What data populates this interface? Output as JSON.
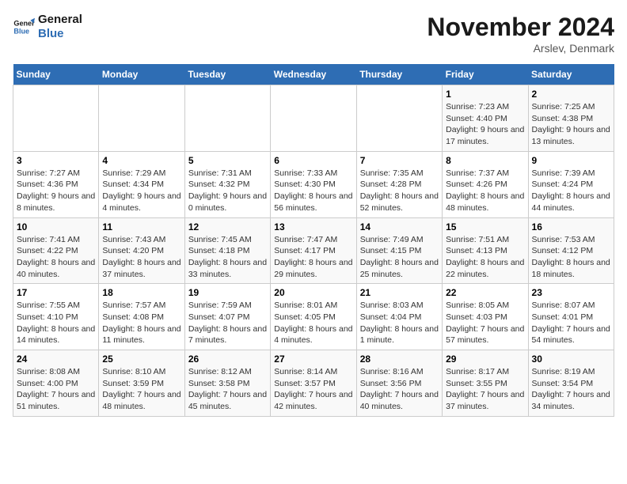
{
  "logo": {
    "line1": "General",
    "line2": "Blue"
  },
  "title": "November 2024",
  "subtitle": "Arslev, Denmark",
  "days_of_week": [
    "Sunday",
    "Monday",
    "Tuesday",
    "Wednesday",
    "Thursday",
    "Friday",
    "Saturday"
  ],
  "weeks": [
    [
      {
        "day": "",
        "info": ""
      },
      {
        "day": "",
        "info": ""
      },
      {
        "day": "",
        "info": ""
      },
      {
        "day": "",
        "info": ""
      },
      {
        "day": "",
        "info": ""
      },
      {
        "day": "1",
        "info": "Sunrise: 7:23 AM\nSunset: 4:40 PM\nDaylight: 9 hours and 17 minutes."
      },
      {
        "day": "2",
        "info": "Sunrise: 7:25 AM\nSunset: 4:38 PM\nDaylight: 9 hours and 13 minutes."
      }
    ],
    [
      {
        "day": "3",
        "info": "Sunrise: 7:27 AM\nSunset: 4:36 PM\nDaylight: 9 hours and 8 minutes."
      },
      {
        "day": "4",
        "info": "Sunrise: 7:29 AM\nSunset: 4:34 PM\nDaylight: 9 hours and 4 minutes."
      },
      {
        "day": "5",
        "info": "Sunrise: 7:31 AM\nSunset: 4:32 PM\nDaylight: 9 hours and 0 minutes."
      },
      {
        "day": "6",
        "info": "Sunrise: 7:33 AM\nSunset: 4:30 PM\nDaylight: 8 hours and 56 minutes."
      },
      {
        "day": "7",
        "info": "Sunrise: 7:35 AM\nSunset: 4:28 PM\nDaylight: 8 hours and 52 minutes."
      },
      {
        "day": "8",
        "info": "Sunrise: 7:37 AM\nSunset: 4:26 PM\nDaylight: 8 hours and 48 minutes."
      },
      {
        "day": "9",
        "info": "Sunrise: 7:39 AM\nSunset: 4:24 PM\nDaylight: 8 hours and 44 minutes."
      }
    ],
    [
      {
        "day": "10",
        "info": "Sunrise: 7:41 AM\nSunset: 4:22 PM\nDaylight: 8 hours and 40 minutes."
      },
      {
        "day": "11",
        "info": "Sunrise: 7:43 AM\nSunset: 4:20 PM\nDaylight: 8 hours and 37 minutes."
      },
      {
        "day": "12",
        "info": "Sunrise: 7:45 AM\nSunset: 4:18 PM\nDaylight: 8 hours and 33 minutes."
      },
      {
        "day": "13",
        "info": "Sunrise: 7:47 AM\nSunset: 4:17 PM\nDaylight: 8 hours and 29 minutes."
      },
      {
        "day": "14",
        "info": "Sunrise: 7:49 AM\nSunset: 4:15 PM\nDaylight: 8 hours and 25 minutes."
      },
      {
        "day": "15",
        "info": "Sunrise: 7:51 AM\nSunset: 4:13 PM\nDaylight: 8 hours and 22 minutes."
      },
      {
        "day": "16",
        "info": "Sunrise: 7:53 AM\nSunset: 4:12 PM\nDaylight: 8 hours and 18 minutes."
      }
    ],
    [
      {
        "day": "17",
        "info": "Sunrise: 7:55 AM\nSunset: 4:10 PM\nDaylight: 8 hours and 14 minutes."
      },
      {
        "day": "18",
        "info": "Sunrise: 7:57 AM\nSunset: 4:08 PM\nDaylight: 8 hours and 11 minutes."
      },
      {
        "day": "19",
        "info": "Sunrise: 7:59 AM\nSunset: 4:07 PM\nDaylight: 8 hours and 7 minutes."
      },
      {
        "day": "20",
        "info": "Sunrise: 8:01 AM\nSunset: 4:05 PM\nDaylight: 8 hours and 4 minutes."
      },
      {
        "day": "21",
        "info": "Sunrise: 8:03 AM\nSunset: 4:04 PM\nDaylight: 8 hours and 1 minute."
      },
      {
        "day": "22",
        "info": "Sunrise: 8:05 AM\nSunset: 4:03 PM\nDaylight: 7 hours and 57 minutes."
      },
      {
        "day": "23",
        "info": "Sunrise: 8:07 AM\nSunset: 4:01 PM\nDaylight: 7 hours and 54 minutes."
      }
    ],
    [
      {
        "day": "24",
        "info": "Sunrise: 8:08 AM\nSunset: 4:00 PM\nDaylight: 7 hours and 51 minutes."
      },
      {
        "day": "25",
        "info": "Sunrise: 8:10 AM\nSunset: 3:59 PM\nDaylight: 7 hours and 48 minutes."
      },
      {
        "day": "26",
        "info": "Sunrise: 8:12 AM\nSunset: 3:58 PM\nDaylight: 7 hours and 45 minutes."
      },
      {
        "day": "27",
        "info": "Sunrise: 8:14 AM\nSunset: 3:57 PM\nDaylight: 7 hours and 42 minutes."
      },
      {
        "day": "28",
        "info": "Sunrise: 8:16 AM\nSunset: 3:56 PM\nDaylight: 7 hours and 40 minutes."
      },
      {
        "day": "29",
        "info": "Sunrise: 8:17 AM\nSunset: 3:55 PM\nDaylight: 7 hours and 37 minutes."
      },
      {
        "day": "30",
        "info": "Sunrise: 8:19 AM\nSunset: 3:54 PM\nDaylight: 7 hours and 34 minutes."
      }
    ]
  ]
}
